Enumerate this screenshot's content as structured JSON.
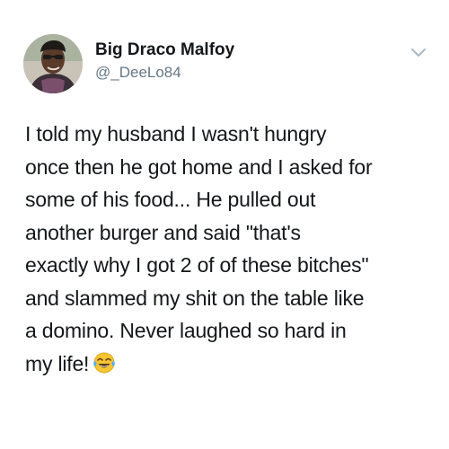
{
  "tweet": {
    "display_name": "Big Draco Malfoy",
    "handle": "@_DeeLo84",
    "icons": {
      "avatar": "profile-photo",
      "menu": "chevron-down-icon",
      "emoji": "face-with-tears-of-joy-emoji"
    },
    "colors": {
      "text": "#14171a",
      "secondary": "#657786",
      "chevron": "#aab8c2",
      "background": "#ffffff"
    },
    "lines": [
      "I told my husband I wasn't hungry",
      "once then he got home and I asked for",
      "some of his food... He pulled out",
      "another burger and said \"that's",
      "exactly why I got 2 of of these bitches\"",
      "and slammed my shit on the table like",
      "a domino. Never laughed so hard in",
      "my life!"
    ]
  }
}
